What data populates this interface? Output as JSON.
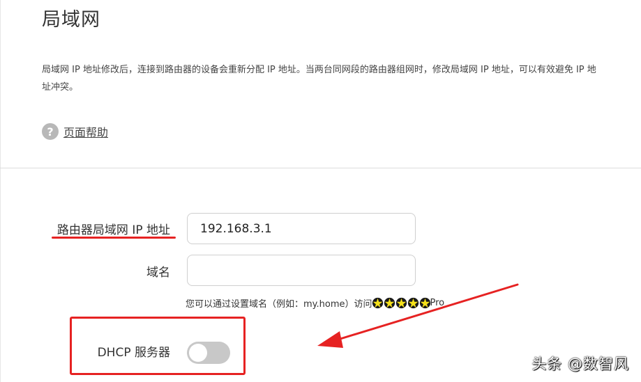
{
  "page": {
    "title": "局域网",
    "description": "局域网 IP 地址修改后，连接到路由器的设备会重新分配 IP 地址。当两台同网段的路由器组网时，修改局域网 IP 地址，可以有效避免 IP 地址冲突。",
    "help_icon": "question-circle-icon",
    "help_label": "页面帮助"
  },
  "form": {
    "lan_ip_label": "路由器局域网 IP 地址",
    "lan_ip_value": "192.168.3.1",
    "domain_label": "域名",
    "domain_value": "",
    "hint_prefix": "您可以通过设置域名（例如：my.home）访问",
    "hint_suffix": "Pro",
    "dhcp_label": "DHCP 服务器",
    "dhcp_enabled": false
  },
  "annotations": {
    "highlight_color": "#e62222"
  },
  "watermark": "头条 @数智风"
}
